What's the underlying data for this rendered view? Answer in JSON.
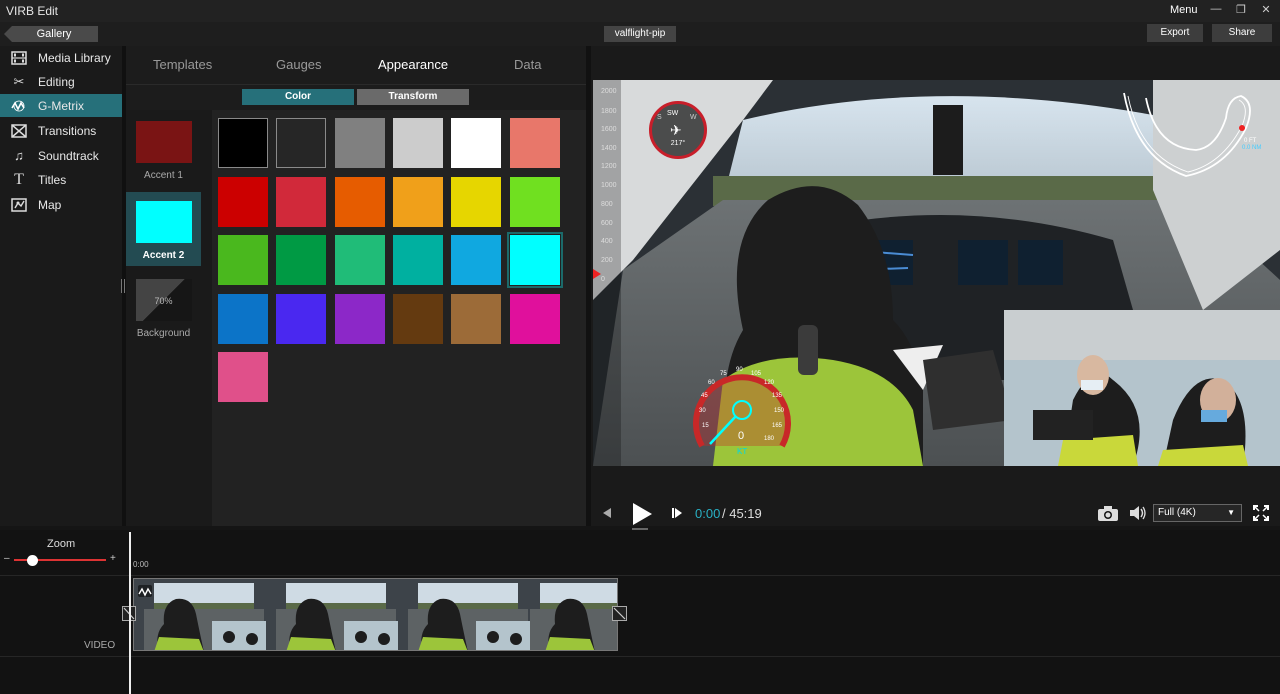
{
  "app": {
    "title": "VIRB Edit",
    "menu_label": "Menu"
  },
  "toolbar": {
    "gallery_label": "Gallery",
    "project_name": "valflight-pip",
    "export_label": "Export",
    "share_label": "Share"
  },
  "sidebar": {
    "items": [
      {
        "label": "Media Library",
        "icon": "film-icon"
      },
      {
        "label": "Editing",
        "icon": "scissors-icon"
      },
      {
        "label": "G-Metrix",
        "icon": "g-metrix-icon",
        "active": true
      },
      {
        "label": "Transitions",
        "icon": "transition-icon"
      },
      {
        "label": "Soundtrack",
        "icon": "music-note-icon"
      },
      {
        "label": "Titles",
        "icon": "title-t-icon"
      },
      {
        "label": "Map",
        "icon": "map-icon"
      }
    ]
  },
  "panel": {
    "tabs": [
      {
        "label": "Templates"
      },
      {
        "label": "Gauges"
      },
      {
        "label": "Appearance",
        "active": true
      },
      {
        "label": "Data"
      }
    ],
    "subtabs": {
      "color": "Color",
      "transform": "Transform"
    },
    "accents": [
      {
        "label": "Accent 1",
        "color": "#7a1414"
      },
      {
        "label": "Accent 2",
        "color": "#00ffff",
        "active": true
      },
      {
        "label": "Background",
        "opacity": "70%"
      }
    ],
    "swatches": [
      "#000000",
      "#262626",
      "#808080",
      "#cccccc",
      "#ffffff",
      "#e8776a",
      "#cc0000",
      "#d1293a",
      "#e65c00",
      "#f0a01a",
      "#e6d600",
      "#70e020",
      "#4ab81e",
      "#009a44",
      "#20bc78",
      "#00b0a0",
      "#10a8e0",
      "#00ffff",
      "#0c74c8",
      "#4a28f0",
      "#8c28c8",
      "#643a10",
      "#9c6b38",
      "#e0109c",
      "#e0508a"
    ]
  },
  "player": {
    "current_time": "0:00",
    "total_time": "/ 45:19",
    "quality": "Full (4K)",
    "altitude_ticks": [
      "2000",
      "1800",
      "1600",
      "1400",
      "1200",
      "1000",
      "800",
      "600",
      "400",
      "200",
      "0"
    ],
    "compass_heading": "217°",
    "compass_dirs": [
      "S",
      "SW",
      "W"
    ],
    "speed_value": "0",
    "speed_unit": "KT",
    "speed_ticks": [
      "30",
      "45",
      "60",
      "75",
      "90",
      "105",
      "120",
      "135",
      "150",
      "165",
      "180",
      "15"
    ],
    "map_distance": "0 FT",
    "map_distance2": "0.0 NM"
  },
  "timeline": {
    "zoom_label": "Zoom",
    "zoom_minus": "–",
    "zoom_plus": "+",
    "time_start": "0:00",
    "track_label": "VIDEO"
  }
}
